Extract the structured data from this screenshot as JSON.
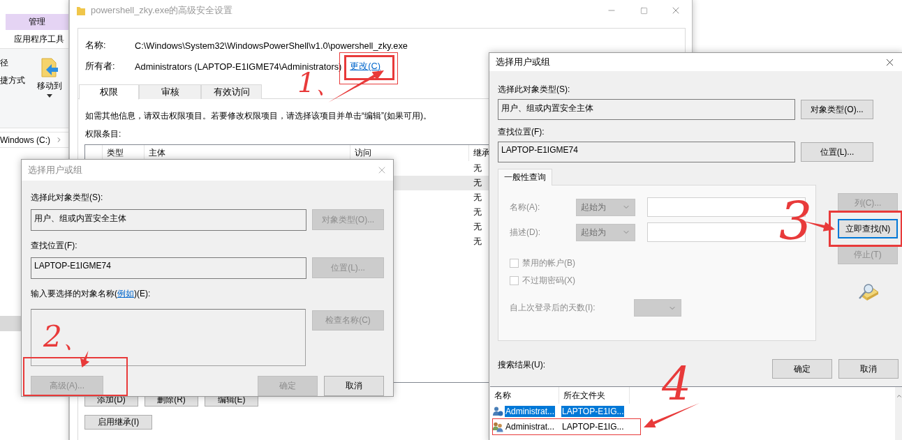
{
  "explorer": {
    "ribbon_tab": "管理",
    "ribbon_group": "应用程序工具",
    "ribbon_labels": [
      "径",
      "捷方式"
    ],
    "move_button": "移动到",
    "breadcrumb": "Windows (C:)"
  },
  "security": {
    "title": "powershell_zky.exe的高级安全设置",
    "name_label": "名称:",
    "name_value": "C:\\Windows\\System32\\WindowsPowerShell\\v1.0\\powershell_zky.exe",
    "owner_label": "所有者:",
    "owner_value": "Administrators (LAPTOP-E1IGME74\\Administrators)",
    "change_link": "更改(C)",
    "tabs": [
      {
        "label": "权限",
        "selected": true
      },
      {
        "label": "审核",
        "selected": false
      },
      {
        "label": "有效访问",
        "selected": false
      }
    ],
    "info": "如需其他信息，请双击权限项目。若要修改权限项目，请选择该项目并单击“编辑”(如果可用)。",
    "entries_label": "权限条目:",
    "columns": [
      "类型",
      "主体",
      "访问",
      "继承"
    ],
    "rows": [
      {
        "inheritance": "无",
        "selected": false
      },
      {
        "inheritance": "无",
        "selected": true
      },
      {
        "inheritance": "无",
        "selected": false
      },
      {
        "inheritance": "无",
        "selected": false
      },
      {
        "inheritance": "无",
        "selected": false
      },
      {
        "inheritance": "无",
        "selected": false
      }
    ],
    "buttons": [
      "添加(D)",
      "删除(R)",
      "编辑(E)"
    ],
    "enable_inheritance": "启用继承(I)"
  },
  "dialog_back": {
    "title": "选择用户或组",
    "active": false,
    "object_type_label": "选择此对象类型(S):",
    "object_type": "用户、组或内置安全主体",
    "object_type_button": {
      "label": "对象类型(O)...",
      "disabled": true
    },
    "location_label": "查找位置(F):",
    "location": "LAPTOP-E1IGME74",
    "location_button": {
      "label": "位置(L)...",
      "disabled": true
    },
    "names_label": "输入要选择的对象名称(",
    "names_link": "例如",
    "names_label_end": ")(E):",
    "check_button": {
      "label": "检查名称(C)",
      "disabled": true
    },
    "advanced_button": {
      "label": "高级(A)...",
      "disabled": true
    },
    "ok_button": {
      "label": "确定",
      "disabled": true
    },
    "cancel_button": {
      "label": "取消",
      "disabled": false
    }
  },
  "dialog_front": {
    "title": "选择用户或组",
    "active": true,
    "object_type_label": "选择此对象类型(S):",
    "object_type": "用户、组或内置安全主体",
    "object_type_button": "对象类型(O)...",
    "location_label": "查找位置(F):",
    "location": "LAPTOP-E1IGME74",
    "location_button": "位置(L)...",
    "query_tab": "一般性查询",
    "query_disabled": true,
    "query_fields": [
      {
        "label": "名称(A):",
        "match": "起始为"
      },
      {
        "label": "描述(D):",
        "match": "起始为"
      }
    ],
    "checkboxes": [
      {
        "label": "禁用的帐户(B)",
        "checked": false
      },
      {
        "label": "不过期密码(X)",
        "checked": false
      }
    ],
    "days_label": "自上次登录后的天数(I):",
    "side_buttons": [
      {
        "label": "列(C)...",
        "disabled": true,
        "focused": false
      },
      {
        "label": "立即查找(N)",
        "disabled": false,
        "focused": true
      },
      {
        "label": "停止(T)",
        "disabled": true,
        "focused": false
      }
    ],
    "ok_button": "确定",
    "cancel_button": "取消",
    "results_label": "搜索结果(U):",
    "result_columns": [
      "名称",
      "所在文件夹"
    ],
    "results": [
      {
        "name": "Administrat...",
        "folder": "LAPTOP-E1IG...",
        "kind": "user",
        "selected": true
      },
      {
        "name": "Administrat...",
        "folder": "LAPTOP-E1IG...",
        "kind": "group",
        "selected": false
      }
    ]
  },
  "annotations": [
    {
      "label": "1、"
    },
    {
      "label": "2、"
    },
    {
      "label": "3"
    },
    {
      "label": "4"
    }
  ]
}
